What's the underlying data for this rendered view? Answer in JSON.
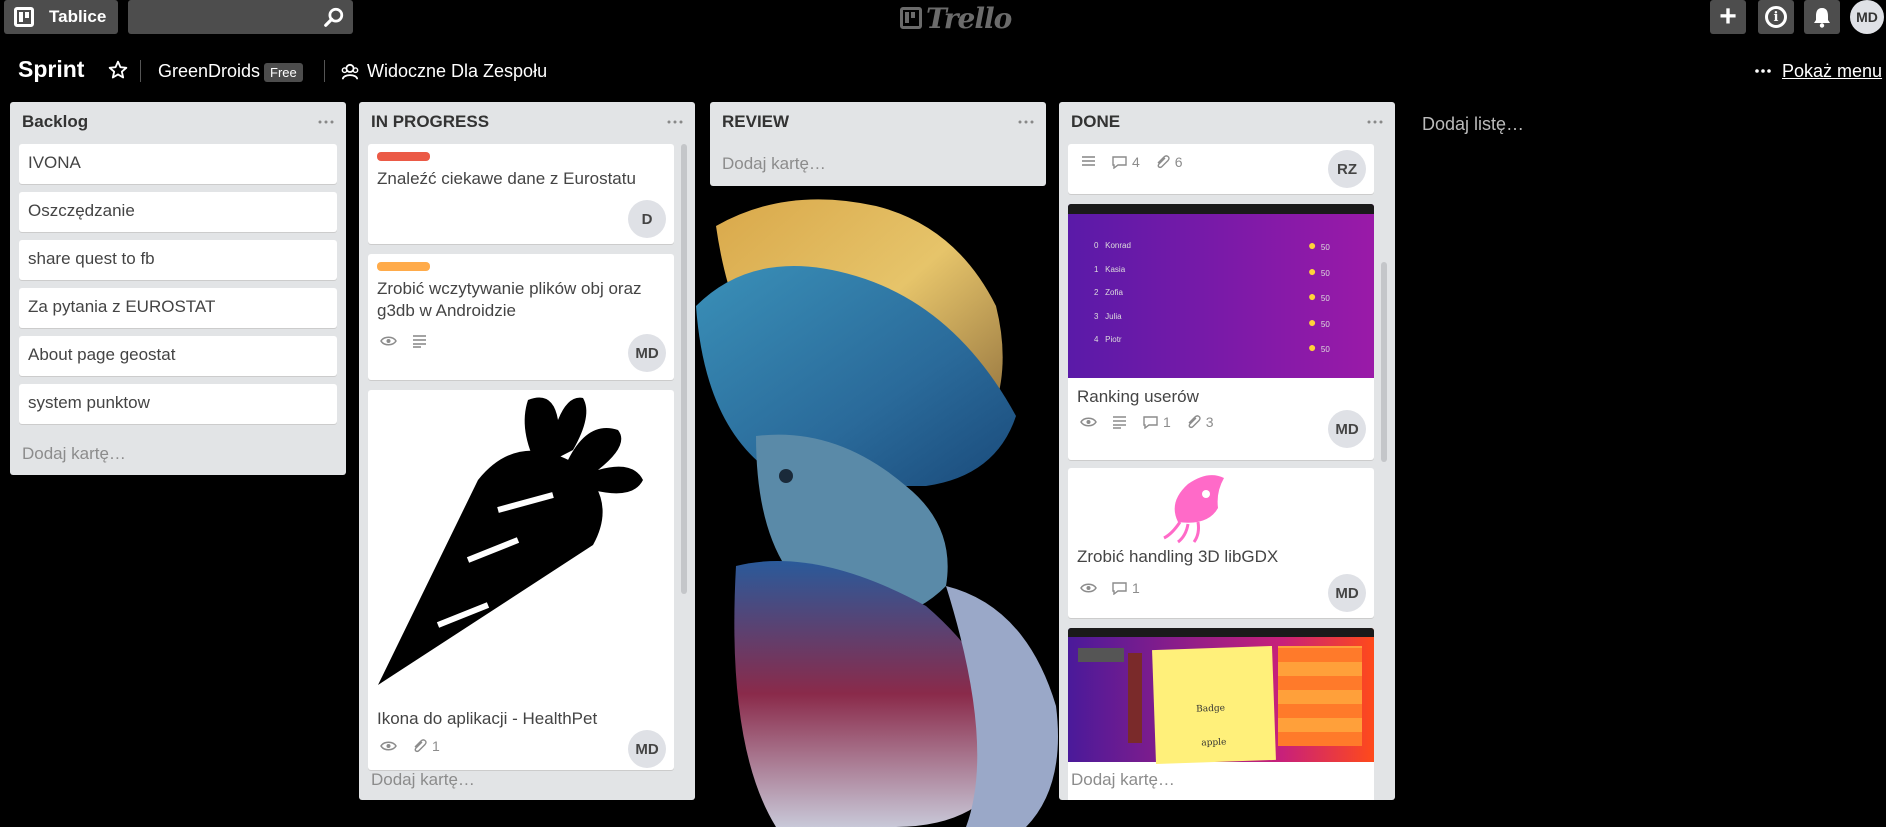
{
  "header": {
    "boards_label": "Tablice",
    "search_placeholder": "",
    "logo_text": "Trello",
    "add_label": "+",
    "info_label": "i",
    "user_initials": "MD"
  },
  "board": {
    "title": "Sprint",
    "team": "GreenDroids",
    "plan_badge": "Free",
    "visibility": "Widoczne Dla Zespołu",
    "show_menu": "Pokaż menu",
    "add_list": "Dodaj listę…"
  },
  "lists": [
    {
      "title": "Backlog",
      "add_card": "Dodaj kartę…",
      "cards": [
        "IVONA",
        "Oszczędzanie",
        "share quest to fb",
        "Za pytania z EUROSTAT",
        "About page geostat",
        "system punktow"
      ]
    },
    {
      "title": "IN PROGRESS",
      "add_card": "Dodaj kartę…",
      "cards": [
        {
          "title": "Znaleźć ciekawe dane z Eurostatu",
          "label_color": "#eb5a46",
          "member": "D"
        },
        {
          "title": "Zrobić wczytywanie plików obj oraz g3db w Androidzie",
          "label_color": "#ffab4a",
          "member": "MD"
        },
        {
          "title": "Ikona do aplikacji - HealthPet",
          "member": "MD",
          "attachments": "1"
        }
      ]
    },
    {
      "title": "REVIEW",
      "add_card": "Dodaj kartę…",
      "cards": []
    },
    {
      "title": "DONE",
      "add_card": "Dodaj kartę…",
      "cards": [
        {
          "title": "",
          "comments": "4",
          "attachments": "6",
          "member": "RZ"
        },
        {
          "title": "Ranking userów",
          "comments": "1",
          "attachments": "3",
          "member": "MD",
          "cover_rows": [
            {
              "rank": "0",
              "name": "Konrad",
              "score": "50"
            },
            {
              "rank": "1",
              "name": "Kasia",
              "score": "50"
            },
            {
              "rank": "2",
              "name": "Zofia",
              "score": "50"
            },
            {
              "rank": "3",
              "name": "Julia",
              "score": "50"
            },
            {
              "rank": "4",
              "name": "Piotr",
              "score": "50"
            }
          ]
        },
        {
          "title": "Zrobić handling 3D libGDX",
          "comments": "1",
          "member": "MD"
        },
        {
          "title": "",
          "cover_texts": [
            "Badge",
            "apple"
          ]
        }
      ]
    }
  ],
  "colors": {
    "background": "#000000",
    "list_bg": "#e2e4e6",
    "header_btn": "#4d4d4d",
    "label_red": "#eb5a46",
    "label_orange": "#ffab4a"
  }
}
